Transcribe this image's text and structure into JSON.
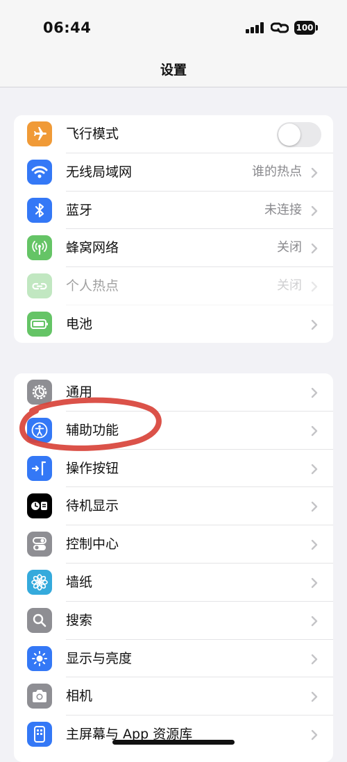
{
  "status_bar": {
    "time": "06:44",
    "battery": "100"
  },
  "nav": {
    "title": "设置"
  },
  "groups": [
    {
      "rows": [
        {
          "label": "飞行模式",
          "icon": "airplane-icon",
          "color": "#f09a37",
          "toggle": false
        },
        {
          "label": "无线局域网",
          "value": "谁的热点",
          "icon": "wifi-icon",
          "color": "#3478f6"
        },
        {
          "label": "蓝牙",
          "value": "未连接",
          "icon": "bluetooth-icon",
          "color": "#3478f6"
        },
        {
          "label": "蜂窝网络",
          "value": "关闭",
          "icon": "antenna-icon",
          "color": "#65c466"
        },
        {
          "label": "个人热点",
          "value": "关闭",
          "icon": "hotspot-icon",
          "color": "#65c466",
          "disabled": true
        },
        {
          "label": "电池",
          "icon": "battery-icon",
          "color": "#65c466"
        }
      ]
    },
    {
      "rows": [
        {
          "label": "通用",
          "icon": "gear-icon",
          "color": "#8e8e93"
        },
        {
          "label": "辅助功能",
          "icon": "accessibility-icon",
          "color": "#3478f6",
          "highlighted": true
        },
        {
          "label": "操作按钮",
          "icon": "action-button-icon",
          "color": "#3478f6"
        },
        {
          "label": "待机显示",
          "icon": "standby-icon",
          "color": "#000000"
        },
        {
          "label": "控制中心",
          "icon": "control-center-icon",
          "color": "#8e8e93"
        },
        {
          "label": "墙纸",
          "icon": "flower-icon",
          "color": "#35aadc"
        },
        {
          "label": "搜索",
          "icon": "search-icon",
          "color": "#8e8e93"
        },
        {
          "label": "显示与亮度",
          "icon": "brightness-icon",
          "color": "#3478f6"
        },
        {
          "label": "相机",
          "icon": "camera-icon",
          "color": "#8e8e93"
        },
        {
          "label": "主屏幕与 App 资源库",
          "icon": "home-screen-icon",
          "color": "#3478f6"
        }
      ]
    }
  ],
  "annotation": {
    "color": "#d8433a"
  }
}
